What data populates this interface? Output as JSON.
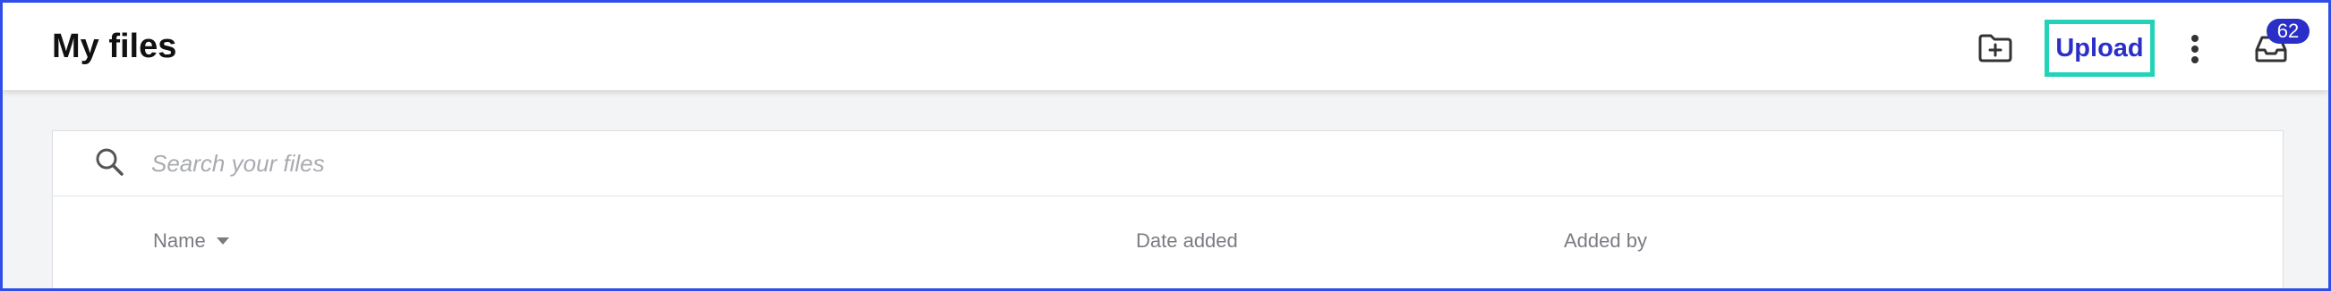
{
  "header": {
    "title": "My files",
    "upload_label": "Upload",
    "notification_count": "62",
    "icons": {
      "new_folder": "folder-plus-icon",
      "more": "more-vertical-icon",
      "inbox": "inbox-icon"
    }
  },
  "search": {
    "placeholder": "Search your files"
  },
  "table": {
    "columns": [
      {
        "label": "Name",
        "sortable": true,
        "sort": "descending"
      },
      {
        "label": "Date added"
      },
      {
        "label": "Added by"
      }
    ]
  },
  "colors": {
    "accent": "#2a2fc8",
    "focus_ring": "#22d3b8",
    "frame": "#2f4ee8"
  }
}
